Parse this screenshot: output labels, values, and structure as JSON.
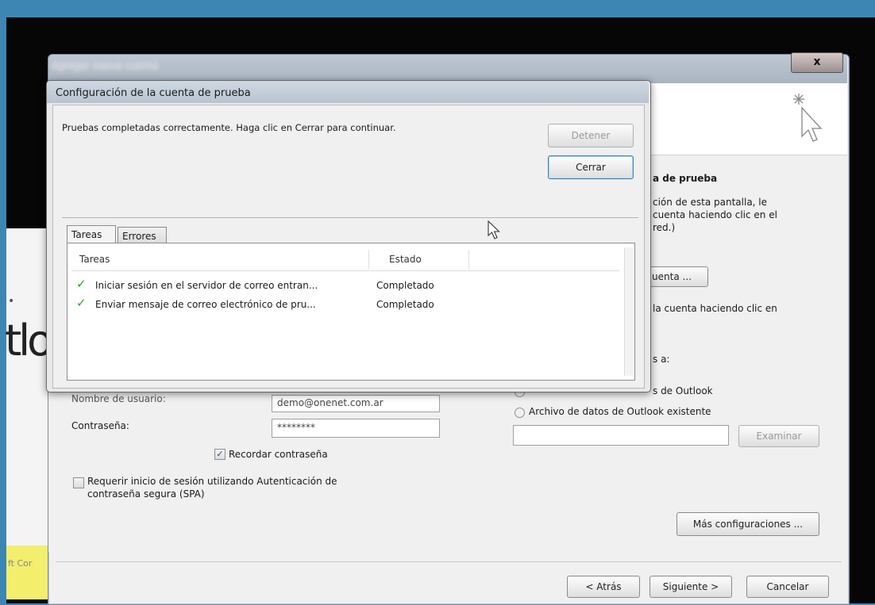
{
  "main_dialog": {
    "title": "Agregar nueva cuenta",
    "close_label": "x",
    "right_panel": {
      "heading_fragment": "a de prueba",
      "text_line1": "ción de esta pantalla, le",
      "text_line2": "cuenta haciendo clic en el",
      "text_line3": "red.)",
      "test_button_fragment": "uenta ...",
      "text_line4": "la cuenta haciendo clic en",
      "deliver_fragment": "s a:",
      "radio_new_fragment": "s de Outlook",
      "radio_existing": "Archivo de datos de Outlook existente",
      "browse_button": "Examinar",
      "more_settings_button": "Más configuraciones ..."
    },
    "login": {
      "username_label": "Nombre de usuario:",
      "username_value": "demo@onenet.com.ar",
      "password_label": "Contraseña:",
      "password_value": "********",
      "remember_label": "Recordar contraseña",
      "spa_label_line1": "Requerir inicio de sesión utilizando Autenticación de",
      "spa_label_line2": "contraseña segura (SPA)"
    },
    "footer": {
      "back_button": "< Atrás",
      "next_button": "Siguiente >",
      "cancel_button": "Cancelar"
    }
  },
  "test_dialog": {
    "title": "Configuración de la cuenta de prueba",
    "message": "Pruebas completadas correctamente. Haga clic en Cerrar para continuar.",
    "stop_button": "Detener",
    "close_button": "Cerrar",
    "tabs": [
      {
        "label": "Tareas"
      },
      {
        "label": "Errores"
      }
    ],
    "columns": [
      "Tareas",
      "Estado"
    ],
    "rows": [
      {
        "task": "Iniciar sesión en el servidor de correo entran...",
        "state": "Completado"
      },
      {
        "task": "Enviar mensaje de correo electrónico de pru...",
        "state": "Completado"
      }
    ]
  },
  "background": {
    "logo_fragment": "tlo",
    "footer_fragment": "ft Cor"
  }
}
